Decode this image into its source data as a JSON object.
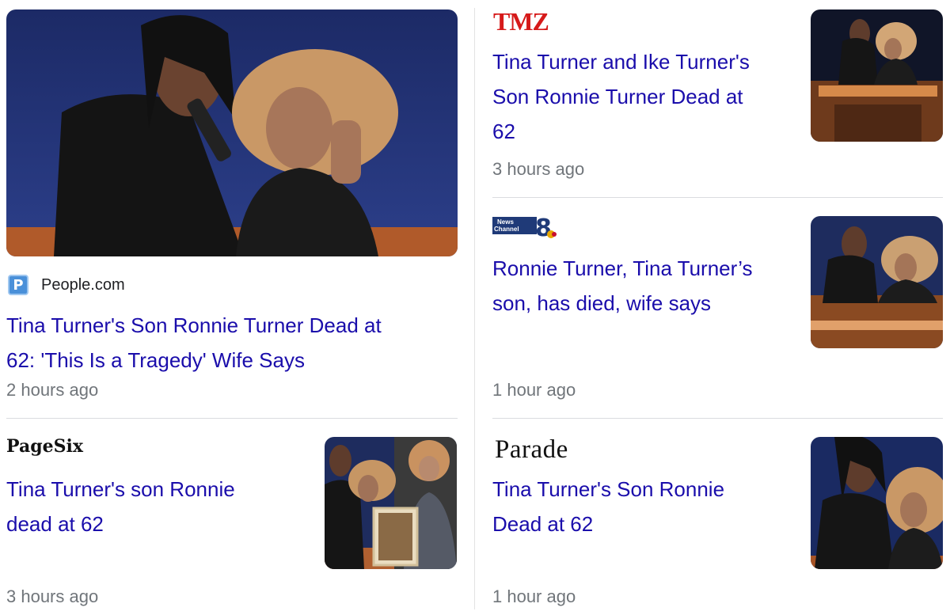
{
  "cards": [
    {
      "id": "people",
      "source": "People.com",
      "source_icon_letter": "P",
      "headline_line1": "Tina Turner's Son Ronnie Turner Dead at",
      "headline_line2": "62: 'This Is a Tragedy' Wife Says",
      "time": "2 hours ago"
    },
    {
      "id": "tmz",
      "source": "TMZ",
      "headline_line1": "Tina Turner and Ike Turner's",
      "headline_line2": "Son Ronnie Turner Dead at",
      "headline_line3": "62",
      "time": "3 hours ago"
    },
    {
      "id": "news8",
      "source_logo_line1": "News",
      "source_logo_line2": "Channel",
      "source_logo_number": "8",
      "headline_line1": "Ronnie Turner, Tina Turner’s",
      "headline_line2": "son, has died, wife says",
      "time": "1 hour ago"
    },
    {
      "id": "pagesix",
      "source": "PageSix",
      "headline_line1": "Tina Turner's son Ronnie",
      "headline_line2": "dead at 62",
      "time": "3 hours ago"
    },
    {
      "id": "parade",
      "source": "Parade",
      "headline_line1": "Tina Turner's Son Ronnie",
      "headline_line2": "Dead at 62",
      "time": "1 hour ago"
    }
  ],
  "colors": {
    "headline": "#1a0dab",
    "time": "#70757a",
    "tmz_red": "#d61a1a",
    "people_blue": "#4a90d9"
  }
}
